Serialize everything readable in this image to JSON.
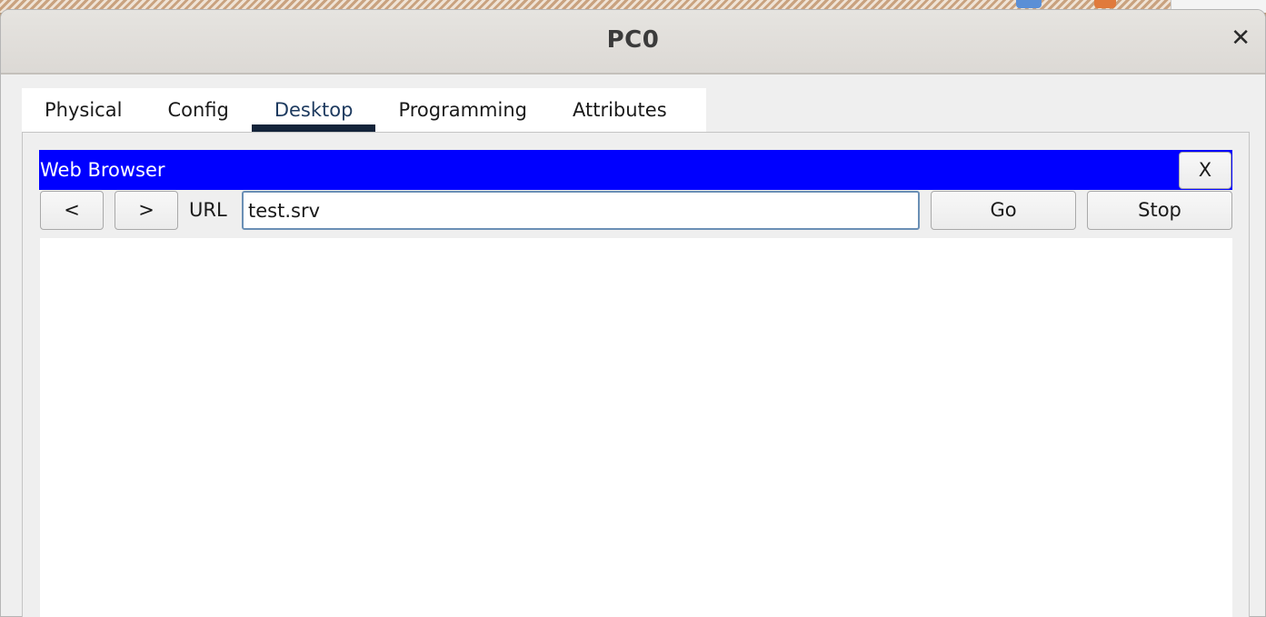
{
  "window": {
    "title": "PC0",
    "close_label": "✕"
  },
  "tabs": [
    {
      "label": "Physical",
      "active": false
    },
    {
      "label": "Config",
      "active": false
    },
    {
      "label": "Desktop",
      "active": true
    },
    {
      "label": "Programming",
      "active": false
    },
    {
      "label": "Attributes",
      "active": false
    }
  ],
  "browser": {
    "title": "Web Browser",
    "close_label": "X",
    "back_label": "<",
    "forward_label": ">",
    "url_label": "URL",
    "url_value": "test.srv",
    "go_label": "Go",
    "stop_label": "Stop",
    "header_color": "#0000ff"
  }
}
